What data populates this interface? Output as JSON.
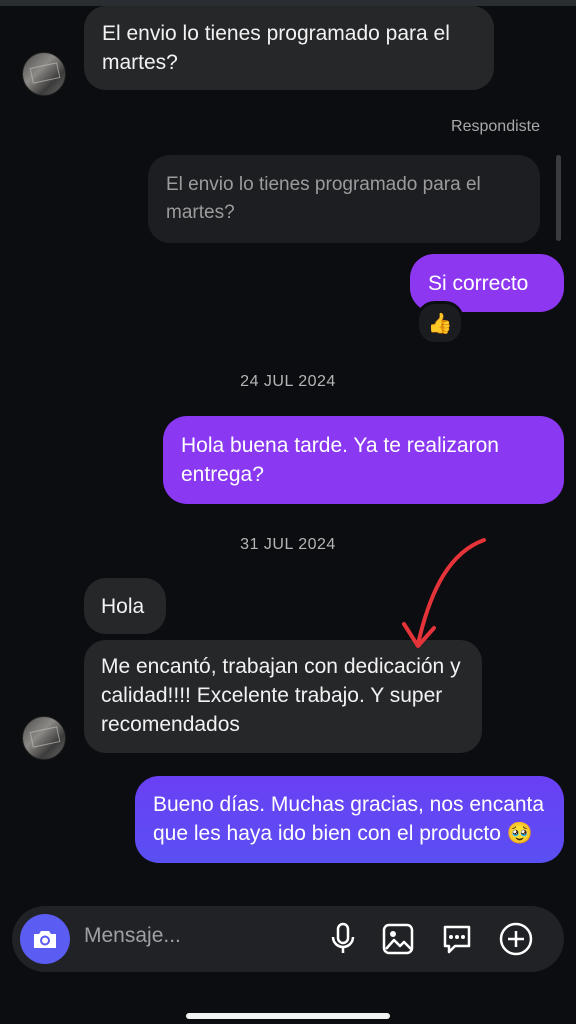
{
  "messages": {
    "m1": "El envio lo tienes programado para el martes?",
    "replied_label": "Respondiste",
    "quoted": "El envio lo tienes programado para el martes?",
    "m2": "Si correcto",
    "m2_reaction": "👍",
    "date1": "24 JUL 2024",
    "m3": "Hola buena tarde. Ya te realizaron entrega?",
    "date2": "31 JUL 2024",
    "m4": "Hola",
    "m5": "Me encantó,  trabajan con dedicación y calidad!!!! Excelente trabajo. Y super recomendados",
    "m6": "Bueno días. Muchas gracias, nos encanta que les haya ido bien con el producto 🥹"
  },
  "composer": {
    "placeholder": "Mensaje...",
    "icons": [
      "camera-icon",
      "microphone-icon",
      "gallery-icon",
      "sticker-icon",
      "plus-icon"
    ]
  },
  "colors": {
    "background": "#0b0d10",
    "incoming_bubble": "#262729",
    "outgoing_purple": "#8a37f2",
    "outgoing_blue": "#6a4df5",
    "annotation_arrow": "#e5333a"
  }
}
